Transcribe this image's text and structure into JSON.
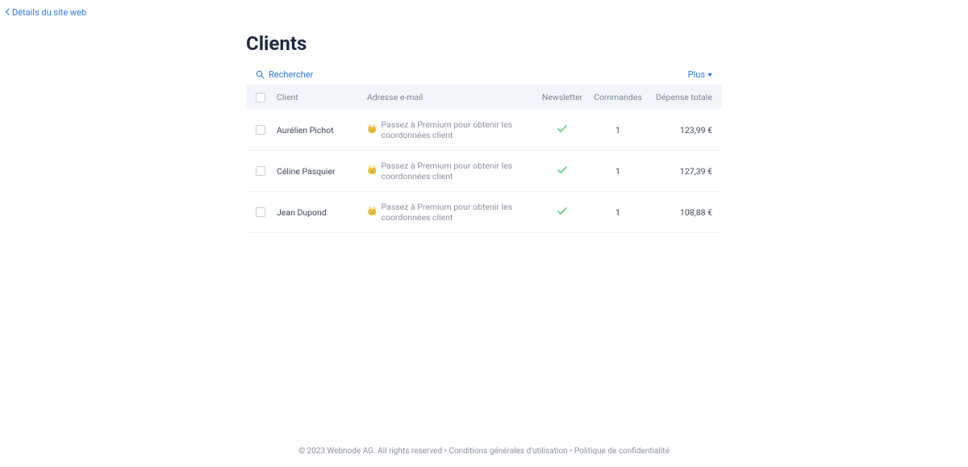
{
  "backLink": "Détails du site web",
  "title": "Clients",
  "searchLabel": "Rechercher",
  "moreLabel": "Plus",
  "columns": {
    "client": "Client",
    "email": "Adresse e-mail",
    "newsletter": "Newsletter",
    "orders": "Commandes",
    "spent": "Dépense totale"
  },
  "premiumNotice": "Passez à Premium pour obtenir les coordonnées client",
  "rows": [
    {
      "name": "Aurélien Pichot",
      "newsletter": true,
      "orders": "1",
      "spent": "123,99 €"
    },
    {
      "name": "Céline Pasquier",
      "newsletter": true,
      "orders": "1",
      "spent": "127,39 €"
    },
    {
      "name": "Jean Dupond",
      "newsletter": true,
      "orders": "1",
      "spent": "108,88 €"
    }
  ],
  "footer": {
    "copyright": "© 2023 Webnode AG. All rights reserved",
    "sep": " • ",
    "terms": "Conditions générales d'utilisation",
    "privacy": "Politique de confidentialité"
  }
}
